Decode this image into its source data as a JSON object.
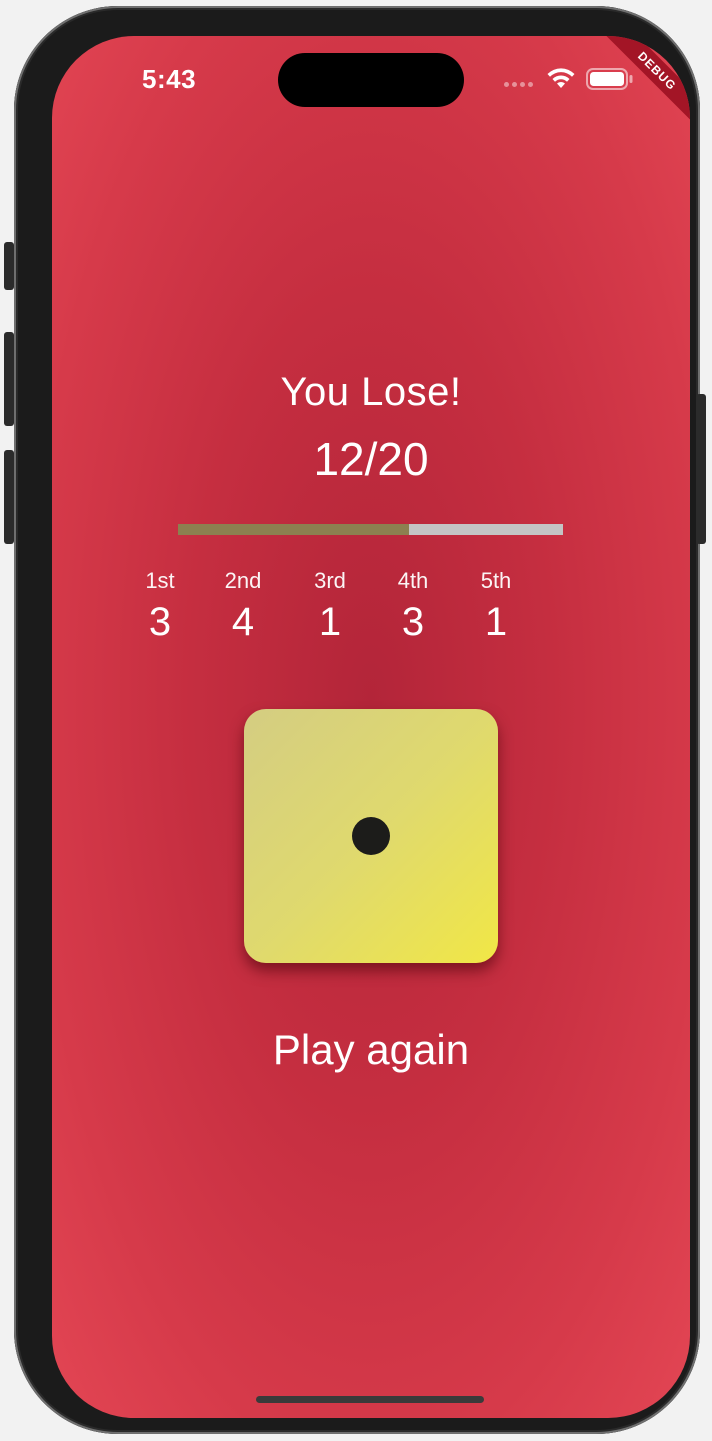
{
  "status_bar": {
    "time": "5:43",
    "wifi_icon": "wifi-icon",
    "battery_icon": "battery-icon",
    "signal_icon": "cellular-signal-icon"
  },
  "debug_banner": "DEBUG",
  "game": {
    "result": "You Lose!",
    "score_text": "12/20",
    "progress": {
      "fraction": 0.6,
      "fill_color": "#8c8050",
      "track_color": "#c4c4c4"
    },
    "rounds": [
      {
        "label": "1st",
        "value": "3"
      },
      {
        "label": "2nd",
        "value": "4"
      },
      {
        "label": "3rd",
        "value": "1"
      },
      {
        "label": "4th",
        "value": "3"
      },
      {
        "label": "5th",
        "value": "1"
      }
    ],
    "die": {
      "face_value": 1,
      "icon": "die-face-one-icon"
    },
    "play_again_label": "Play again"
  },
  "colors": {
    "background": "#c52e40",
    "die_yellow": "#f1e746",
    "text": "#ffffff"
  }
}
